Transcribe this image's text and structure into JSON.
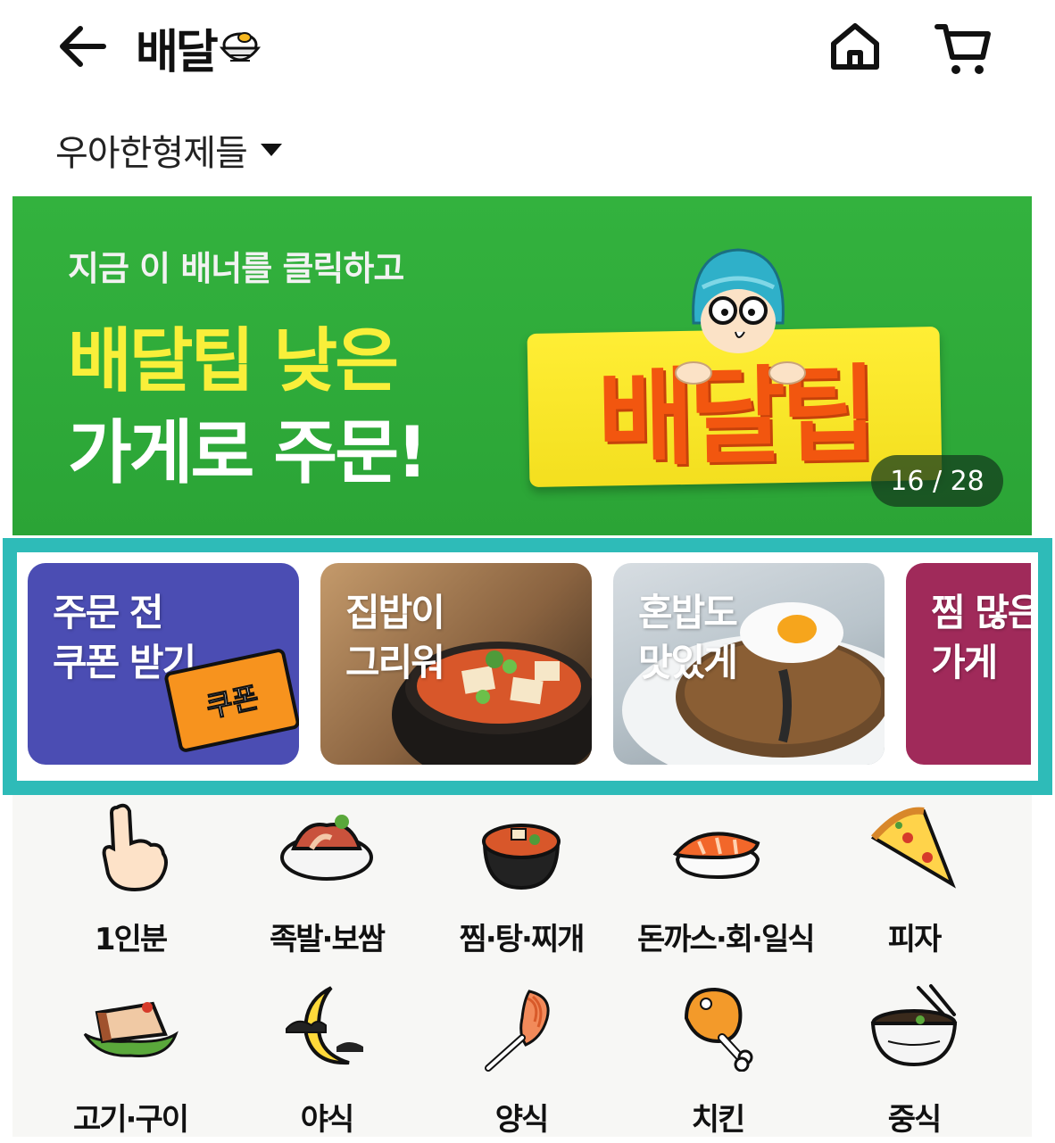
{
  "header": {
    "logo_text": "배달",
    "address": "우아한형제들"
  },
  "banner": {
    "subtitle": "지금 이 배너를 클릭하고",
    "headline_1": "배달팁 낮은",
    "headline_2": "가게로 주문!",
    "sign_text": "배달팁",
    "page_indicator": "16 / 28",
    "current_page": 16,
    "total_pages": 28
  },
  "cards": [
    {
      "title": "주문 전\n쿠폰 받기",
      "badge": "쿠폰"
    },
    {
      "title": "집밥이\n그리워"
    },
    {
      "title": "혼밥도\n맛있게"
    },
    {
      "title": "찜 많은\n가게"
    }
  ],
  "categories": [
    {
      "label": "1인분",
      "icon": "pointing-finger-icon"
    },
    {
      "label": "족발·보쌈",
      "icon": "jokbal-icon"
    },
    {
      "label": "찜·탕·찌개",
      "icon": "stew-pot-icon"
    },
    {
      "label": "돈까스·회·일식",
      "icon": "sushi-icon"
    },
    {
      "label": "피자",
      "icon": "pizza-icon"
    },
    {
      "label": "고기·구이",
      "icon": "grilled-meat-icon"
    },
    {
      "label": "야식",
      "icon": "crescent-moon-icon"
    },
    {
      "label": "양식",
      "icon": "pasta-fork-icon"
    },
    {
      "label": "치킨",
      "icon": "chicken-leg-icon"
    },
    {
      "label": "중식",
      "icon": "noodle-bowl-icon"
    }
  ],
  "colors": {
    "banner_green": "#33b23e",
    "headline_yellow": "#f9ef3a",
    "sign_orange": "#f2560f",
    "highlight_teal": "#2ebbb8",
    "coupon_card": "#4b4db3",
    "steam_card": "#a02a5a"
  }
}
